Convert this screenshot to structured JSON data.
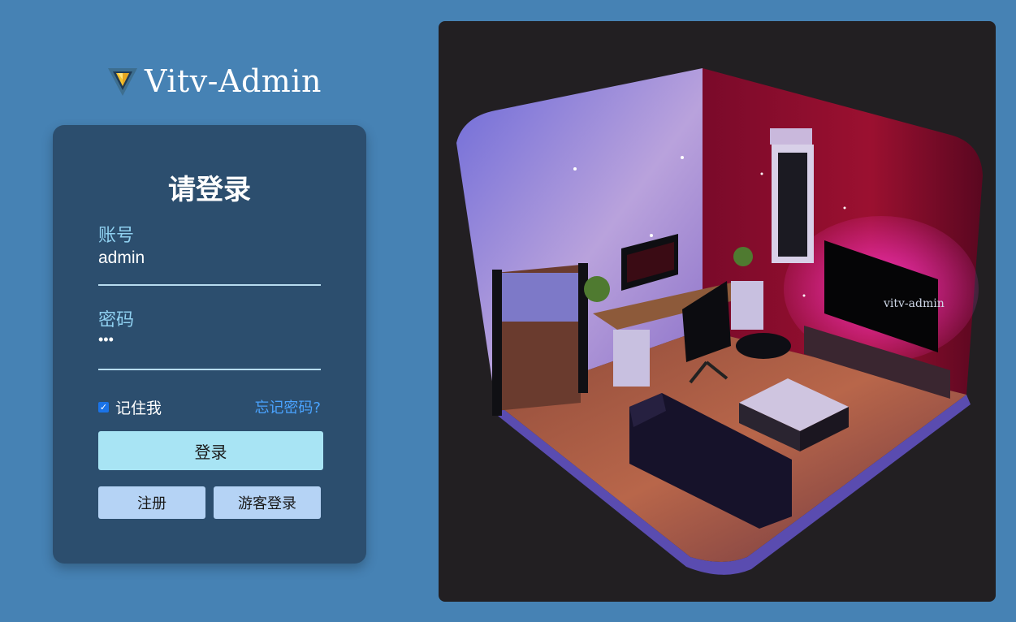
{
  "brand": {
    "title": "Vitv-Admin",
    "logo_icon": "vitv-logo-icon"
  },
  "login": {
    "heading": "请登录",
    "account_label": "账号",
    "account_value": "admin",
    "password_label": "密码",
    "password_value": "•••",
    "remember_label": "记住我",
    "remember_checked": true,
    "forgot_label": "忘记密码?",
    "login_button": "登录",
    "register_button": "注册",
    "guest_button": "游客登录"
  },
  "illustration": {
    "tv_label": "vitv-admin",
    "icon": "isometric-room-illustration"
  },
  "colors": {
    "background": "#4682b4",
    "card": "#2c4e6e",
    "accent_link": "#4aa3ff",
    "login_button": "#a8e4f4",
    "secondary_button": "#b5d3f5"
  }
}
